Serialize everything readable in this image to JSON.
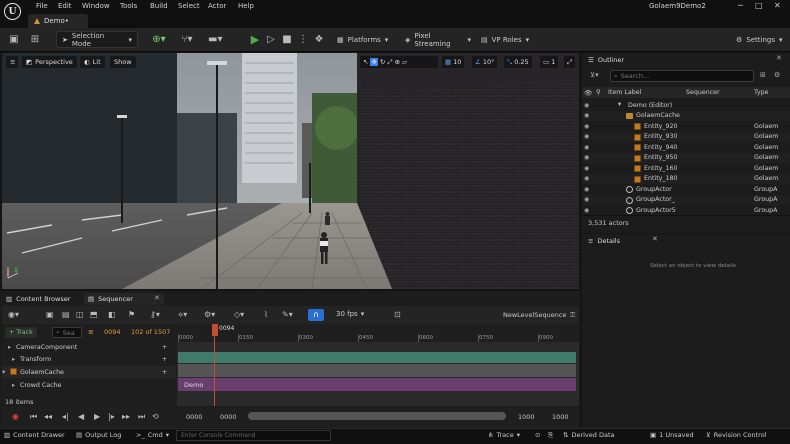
{
  "menubar": {
    "items": [
      "File",
      "Edit",
      "Window",
      "Tools",
      "Build",
      "Select",
      "Actor",
      "Help"
    ],
    "project_name": "Golaem9Demo2"
  },
  "tab": {
    "label": "Demo•"
  },
  "toolbar": {
    "selection_mode": "Selection Mode",
    "platforms": "Platforms",
    "pixel_streaming": "Pixel Streaming",
    "vp_roles": "VP Roles",
    "settings": "Settings"
  },
  "viewport": {
    "perspective": "Perspective",
    "lit": "Lit",
    "show": "Show",
    "grid_snap": "10",
    "rot_snap": "10°",
    "scale_snap": "0.25",
    "cam_speed": "1"
  },
  "outliner": {
    "title": "Outliner",
    "search_placeholder": "Search...",
    "col_label": "Item Label",
    "col_sequencer": "Sequencer",
    "col_type": "Type",
    "rows": [
      {
        "name": "Demo (Editor)",
        "type": "",
        "indent": 36,
        "icon": "world-icon"
      },
      {
        "name": "GolaemCache",
        "type": "",
        "indent": 44,
        "icon": "folder-icon"
      },
      {
        "name": "Entity_920",
        "type": "Golaem",
        "indent": 52,
        "icon": "entity-icon"
      },
      {
        "name": "Entity_930",
        "type": "Golaem",
        "indent": 52,
        "icon": "entity-icon"
      },
      {
        "name": "Entity_940",
        "type": "Golaem",
        "indent": 52,
        "icon": "entity-icon"
      },
      {
        "name": "Entity_950",
        "type": "Golaem",
        "indent": 52,
        "icon": "entity-icon"
      },
      {
        "name": "Entity_160",
        "type": "Golaem",
        "indent": 52,
        "icon": "entity-icon"
      },
      {
        "name": "Entity_180",
        "type": "Golaem",
        "indent": 52,
        "icon": "entity-icon"
      },
      {
        "name": "GroupActor",
        "type": "GroupA",
        "indent": 44,
        "icon": "group-icon"
      },
      {
        "name": "GroupActor_",
        "type": "GroupA",
        "indent": 44,
        "icon": "group-icon"
      },
      {
        "name": "GroupActor5",
        "type": "GroupA",
        "indent": 44,
        "icon": "group-icon"
      }
    ],
    "actor_count": "3,531 actors"
  },
  "details": {
    "title": "Details",
    "empty_hint": "Select an object to view details"
  },
  "bottom_tabs": {
    "content_browser": "Content Browser",
    "sequencer": "Sequencer"
  },
  "sequencer": {
    "fps": "30 fps",
    "sequence_name": "NewLevelSequence",
    "add_track": "+ Track",
    "search_placeholder": "Sea",
    "current_frame": "0094",
    "frame_count": "102 of 1507",
    "playhead_label": "0094",
    "ticks": [
      "0000",
      "0150",
      "0300",
      "0450",
      "0600",
      "0750",
      "0900"
    ],
    "tracks": [
      {
        "name": "CameraComponent",
        "indent": 14
      },
      {
        "name": "Transform",
        "indent": 18
      },
      {
        "name": "GolaemCache",
        "indent": 8
      },
      {
        "name": "Crowd Cache",
        "indent": 18
      }
    ],
    "clip_label": "Demo",
    "items_count": "18 items",
    "range_start": "0000",
    "range_start2": "0000",
    "range_end": "1000",
    "range_end2": "1000"
  },
  "statusbar": {
    "content_drawer": "Content Drawer",
    "output_log": "Output Log",
    "cmd": "Cmd",
    "console_placeholder": "Enter Console Command",
    "trace": "Trace",
    "derived_data": "Derived Data",
    "unsaved": "1 Unsaved",
    "revision_control": "Revision Control"
  }
}
